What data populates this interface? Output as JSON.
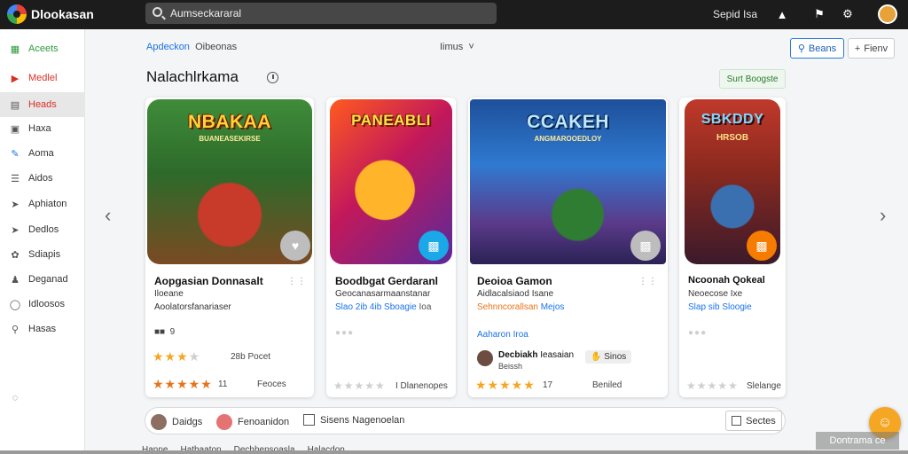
{
  "app": {
    "title": "Dlookasan"
  },
  "search": {
    "value": "Aumseckararal",
    "placeholder": ""
  },
  "topbar": {
    "right_text": "Sepid Isa"
  },
  "sidebar": {
    "items": [
      {
        "label": "Aceets",
        "icon": "grid-icon",
        "color": "#2e9b3a"
      },
      {
        "label": "Medlel",
        "icon": "play-icon",
        "color": "#d93025"
      },
      {
        "label": "Heads",
        "icon": "apps-icon",
        "color": "#d93025",
        "active": true
      },
      {
        "label": "Haxa",
        "icon": "book-icon",
        "color": "#333333"
      },
      {
        "label": "Aoma",
        "icon": "pencil-icon",
        "color": "#333333"
      },
      {
        "label": "Aidos",
        "icon": "list-icon",
        "color": "#333333"
      },
      {
        "label": "Aphiaton",
        "icon": "tag-icon",
        "color": "#333333"
      },
      {
        "label": "Dedlos",
        "icon": "tag-icon",
        "color": "#333333"
      },
      {
        "label": "Sdiapis",
        "icon": "settings-icon",
        "color": "#333333"
      },
      {
        "label": "Deganad",
        "icon": "person-icon",
        "color": "#333333"
      },
      {
        "label": "Idloosos",
        "icon": "globe-icon",
        "color": "#333333"
      },
      {
        "label": "Hasas",
        "icon": "search-icon",
        "color": "#333333"
      }
    ]
  },
  "breadcrumb": {
    "first": "Apdeckon",
    "second": "Oibeonas"
  },
  "filter": {
    "label": "Iimus"
  },
  "header_buttons": {
    "primary": "Beans",
    "secondary": "Fienv"
  },
  "section": {
    "title": "Nalachlrkama",
    "action": "Surt Boogste"
  },
  "cards": [
    {
      "art_title": "NBAKAA",
      "art_sub": "BUANEASEKIRSE",
      "title": "Aopgasian Donnasalt",
      "line1": "Iloeane",
      "line2": "Aoolatorsfanariaser",
      "meta": "9",
      "rating": 3,
      "rating_label": "28b Pocet",
      "rating2": 5,
      "count": "11",
      "footer": "Feoces"
    },
    {
      "art_title": "PANEABLI",
      "title": "Boodbgat Gerdaranl",
      "line1": "Geocanasarmaanstanar",
      "line2": "Slao 2ib 4ib Sboagie",
      "line2_tail": "Ioa",
      "rating": 0,
      "rating2": 0,
      "footer": "I Dlanenopes"
    },
    {
      "art_title": "CCAKEH",
      "art_sub": "ANGMAROOEDLOY",
      "title": "Deoioa Gamon",
      "line1": "Aidlacalsiaod Isane",
      "line2": "Sehnncorallsan",
      "line2_tail": "Mejos",
      "line3": "Aaharon Iroa",
      "author": "Decbiakh",
      "author_tail": "Ieasaian",
      "author_sub": "Beissh",
      "tag": "Sinos",
      "rating": 5,
      "count": "17",
      "footer": "Beniled"
    },
    {
      "art_title": "SBKDDY",
      "art_sub": "HRSOB",
      "title": "Ncoonah Qokeal",
      "line1": "Neoecose Ixe",
      "line2": "Slap sib Sloogie",
      "rating": 0,
      "rating2": 0,
      "footer": "Slelange"
    }
  ],
  "bottom": {
    "items": [
      "Daidgs",
      "Fenoanidon",
      "Sisens Nagenoelan"
    ],
    "button": "Sectes",
    "watermark": "Dontrama ce",
    "peek": [
      "Hanne",
      "Hatbaaton",
      "Dechhensoasla",
      "Halacdon"
    ]
  },
  "colors": {
    "topbar": "#1c1c1c",
    "accent": "#1a73e8",
    "star": "#f5a623",
    "fab": "#f5a623"
  }
}
